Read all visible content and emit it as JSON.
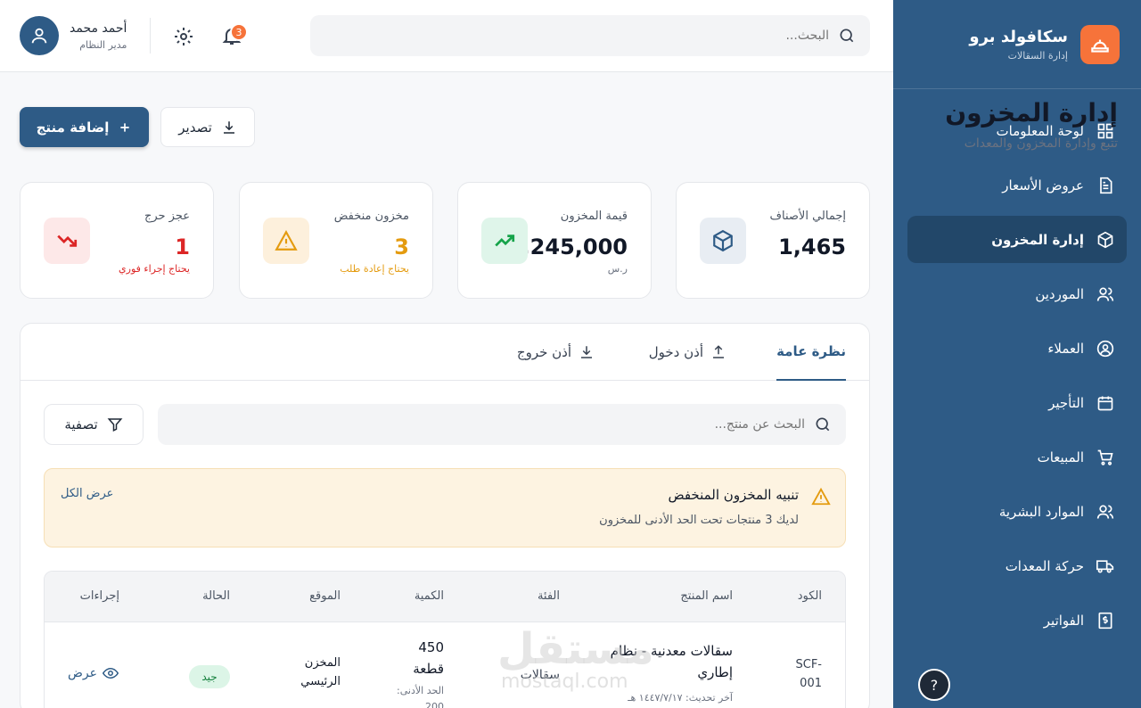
{
  "sidebar": {
    "brand_name": "سكافولد برو",
    "brand_sub": "إدارة السقالات",
    "items": [
      {
        "label": "لوحة المعلومات",
        "icon": "dashboard-icon"
      },
      {
        "label": "عروض الأسعار",
        "icon": "document-icon"
      },
      {
        "label": "إدارة المخزون",
        "icon": "box-icon",
        "active": true
      },
      {
        "label": "الموردين",
        "icon": "users-icon"
      },
      {
        "label": "العملاء",
        "icon": "user-circle-icon"
      },
      {
        "label": "التأجير",
        "icon": "calendar-icon"
      },
      {
        "label": "المبيعات",
        "icon": "cart-icon"
      },
      {
        "label": "الموارد البشرية",
        "icon": "users-icon"
      },
      {
        "label": "حركة المعدات",
        "icon": "truck-icon"
      },
      {
        "label": "الفواتير",
        "icon": "invoice-icon"
      }
    ],
    "help": "?"
  },
  "topbar": {
    "search_placeholder": "البحث...",
    "notifications_count": "3",
    "user_name": "أحمد محمد",
    "user_role": "مدير النظام"
  },
  "header": {
    "title": "إدارة المخزون",
    "subtitle": "تتبع وإدارة المخزون والمعدات",
    "add_label": "إضافة منتج",
    "export_label": "تصدير"
  },
  "stats": [
    {
      "label": "إجمالي الأصناف",
      "value": "1,465",
      "note": "",
      "icon": "box-icon"
    },
    {
      "label": "قيمة المخزون",
      "value": "1,245,000",
      "note": "ر.س",
      "icon": "trend-up-icon"
    },
    {
      "label": "مخزون منخفض",
      "value": "3",
      "note": "يحتاج إعادة طلب",
      "icon": "warning-icon"
    },
    {
      "label": "عجز حرج",
      "value": "1",
      "note": "يحتاج إجراء فوري",
      "icon": "trend-down-icon"
    }
  ],
  "colors": {
    "primary": "#2e5b86",
    "accent": "#f6733a",
    "warning": "#e49b0f",
    "danger": "#dc2626",
    "success": "#16a34a"
  },
  "tabs": [
    {
      "label": "نظرة عامة",
      "active": true
    },
    {
      "label": "أذن دخول",
      "icon": "upload-icon"
    },
    {
      "label": "أذن خروج",
      "icon": "download-icon"
    }
  ],
  "inventory": {
    "search_placeholder": "البحث عن منتج...",
    "filter_label": "تصفية",
    "alert_title": "تنبيه المخزون المنخفض",
    "alert_text": "لديك 3 منتجات تحت الحد الأدنى للمخزون",
    "alert_link": "عرض الكل",
    "columns": [
      "الكود",
      "اسم المنتج",
      "الفئة",
      "الكمية",
      "الموقع",
      "الحالة",
      "إجراءات"
    ],
    "rows": [
      {
        "code": "SCF-001",
        "name": "سقالات معدنية - نظام إطاري",
        "updated": "آخر تحديث: ١٤٤٧/٧/١٧ هـ",
        "category": "سقالات",
        "quantity": "450 قطعة",
        "min": "الحد الأدنى: 200",
        "location": "المخزن الرئيسي",
        "status": "جيد",
        "action": "عرض"
      }
    ]
  },
  "watermark": {
    "text": "مستقل",
    "url": "mostaql.com"
  }
}
